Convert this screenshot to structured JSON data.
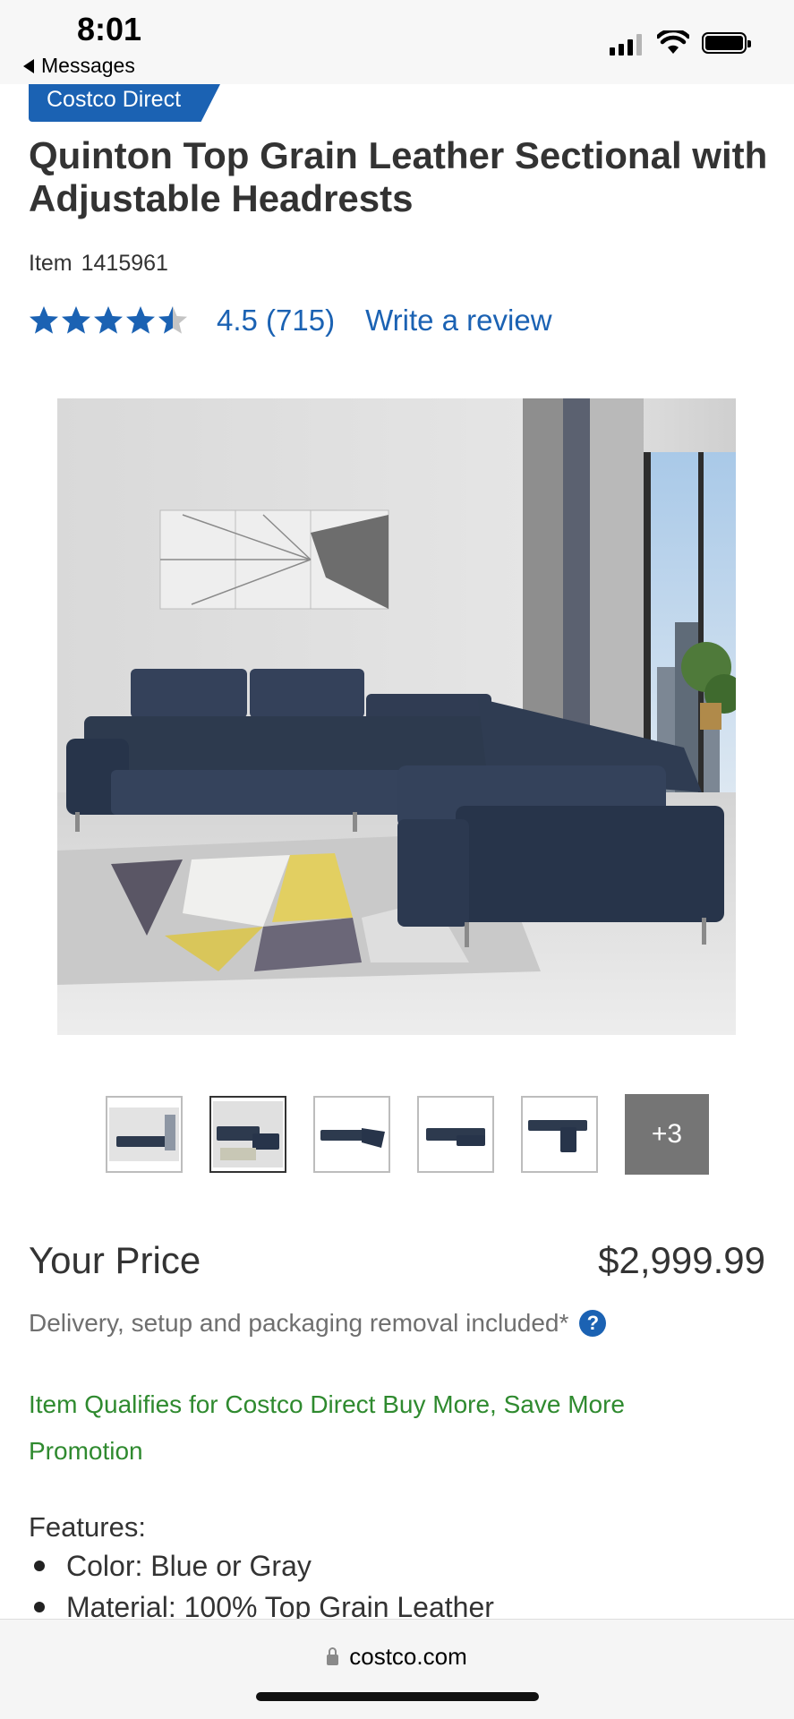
{
  "status_bar": {
    "time": "8:01",
    "back_app": "Messages"
  },
  "badge": "Costco Direct",
  "product": {
    "title": "Quinton Top Grain Leather Sectional with Adjustable Headrests",
    "item_label": "Item",
    "item_number": "1415961",
    "rating": 4.5,
    "rating_text": "4.5",
    "review_count_text": "(715)",
    "write_review": "Write a review"
  },
  "gallery": {
    "thumbnail_count_shown": 5,
    "active_index": 1,
    "more_label": "+3"
  },
  "pricing": {
    "label": "Your Price",
    "value": "$2,999.99",
    "delivery_note": "Delivery, setup and packaging removal included*",
    "help_icon": "question-circle-icon"
  },
  "promo": "Item Qualifies for Costco Direct Buy More, Save More Promotion",
  "features": {
    "title": "Features:",
    "items": [
      "Color: Blue or Gray",
      "Material: 100% Top Grain Leather"
    ]
  },
  "browser": {
    "domain": "costco.com"
  },
  "colors": {
    "brand_blue": "#1b62b3",
    "promo_green": "#2f8a2f",
    "sofa_navy": "#2d3a4e"
  }
}
